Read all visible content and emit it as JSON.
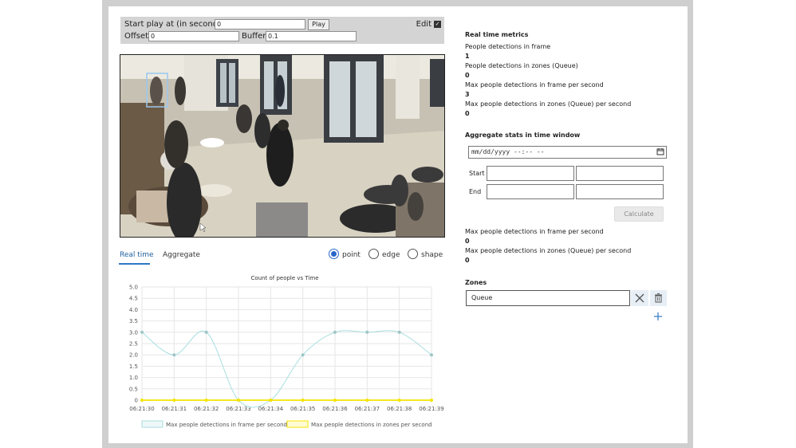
{
  "controls": {
    "start_label": "Start play at (in seconds)",
    "start_value": "0",
    "play_label": "Play",
    "edit_label": "Edit",
    "offset_label": "Offset",
    "offset_value": "0",
    "buffer_label": "Buffer",
    "buffer_value": "0.1"
  },
  "tabs": {
    "realtime": "Real time",
    "aggregate": "Aggregate"
  },
  "view_mode": {
    "options": [
      "point",
      "edge",
      "shape"
    ],
    "selected": "point"
  },
  "realtime_metrics": {
    "title": "Real time metrics",
    "items": [
      {
        "label": "People detections in frame",
        "value": "1"
      },
      {
        "label": "People detections in zones (Queue)",
        "value": "0"
      },
      {
        "label": "Max people detections in frame per second",
        "value": "3"
      },
      {
        "label": "Max people detections in zones (Queue) per second",
        "value": "0"
      }
    ]
  },
  "aggregate": {
    "title": "Aggregate stats in time window",
    "date_placeholder": "mm/dd/yyyy --:-- --",
    "start_label": "Start",
    "end_label": "End",
    "calculate_label": "Calculate",
    "results": [
      {
        "label": "Max people detections in frame per second",
        "value": "0"
      },
      {
        "label": "Max people detections in zones (Queue) per second",
        "value": "0"
      }
    ]
  },
  "zones": {
    "title": "Zones",
    "items": [
      {
        "name": "Queue"
      }
    ]
  },
  "colors": {
    "accent": "#2f78c4",
    "series_frame": "#a8dede",
    "series_zones": "#f5e400"
  },
  "chart_data": {
    "type": "line",
    "title": "Count of people vs Time",
    "x": [
      "06:21:30",
      "06:21:31",
      "06:21:32",
      "06:21:33",
      "06:21:34",
      "06:21:35",
      "06:21:36",
      "06:21:37",
      "06:21:38",
      "06:21:39"
    ],
    "series": [
      {
        "name": "Max people detections in frame per second",
        "values": [
          3,
          2,
          3,
          0,
          0,
          2,
          3,
          3,
          3,
          2
        ]
      },
      {
        "name": "Max people detections in zones per second",
        "values": [
          0,
          0,
          0,
          0,
          0,
          0,
          0,
          0,
          0,
          0
        ]
      }
    ],
    "yticks": [
      "0",
      "0.5",
      "1.0",
      "1.5",
      "2.0",
      "2.5",
      "3.0",
      "3.5",
      "4.0",
      "4.5",
      "5.0"
    ],
    "ylim": [
      0,
      5
    ],
    "grid": true,
    "legend": "bottom"
  }
}
